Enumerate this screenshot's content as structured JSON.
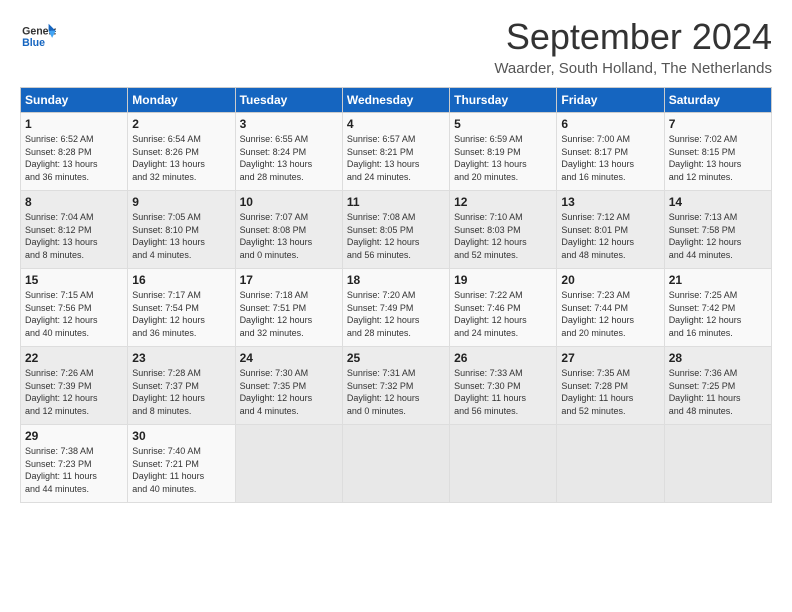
{
  "logo": {
    "line1": "General",
    "line2": "Blue"
  },
  "title": "September 2024",
  "location": "Waarder, South Holland, The Netherlands",
  "days_of_week": [
    "Sunday",
    "Monday",
    "Tuesday",
    "Wednesday",
    "Thursday",
    "Friday",
    "Saturday"
  ],
  "weeks": [
    [
      {
        "day": "1",
        "info": "Sunrise: 6:52 AM\nSunset: 8:28 PM\nDaylight: 13 hours\nand 36 minutes."
      },
      {
        "day": "2",
        "info": "Sunrise: 6:54 AM\nSunset: 8:26 PM\nDaylight: 13 hours\nand 32 minutes."
      },
      {
        "day": "3",
        "info": "Sunrise: 6:55 AM\nSunset: 8:24 PM\nDaylight: 13 hours\nand 28 minutes."
      },
      {
        "day": "4",
        "info": "Sunrise: 6:57 AM\nSunset: 8:21 PM\nDaylight: 13 hours\nand 24 minutes."
      },
      {
        "day": "5",
        "info": "Sunrise: 6:59 AM\nSunset: 8:19 PM\nDaylight: 13 hours\nand 20 minutes."
      },
      {
        "day": "6",
        "info": "Sunrise: 7:00 AM\nSunset: 8:17 PM\nDaylight: 13 hours\nand 16 minutes."
      },
      {
        "day": "7",
        "info": "Sunrise: 7:02 AM\nSunset: 8:15 PM\nDaylight: 13 hours\nand 12 minutes."
      }
    ],
    [
      {
        "day": "8",
        "info": "Sunrise: 7:04 AM\nSunset: 8:12 PM\nDaylight: 13 hours\nand 8 minutes."
      },
      {
        "day": "9",
        "info": "Sunrise: 7:05 AM\nSunset: 8:10 PM\nDaylight: 13 hours\nand 4 minutes."
      },
      {
        "day": "10",
        "info": "Sunrise: 7:07 AM\nSunset: 8:08 PM\nDaylight: 13 hours\nand 0 minutes."
      },
      {
        "day": "11",
        "info": "Sunrise: 7:08 AM\nSunset: 8:05 PM\nDaylight: 12 hours\nand 56 minutes."
      },
      {
        "day": "12",
        "info": "Sunrise: 7:10 AM\nSunset: 8:03 PM\nDaylight: 12 hours\nand 52 minutes."
      },
      {
        "day": "13",
        "info": "Sunrise: 7:12 AM\nSunset: 8:01 PM\nDaylight: 12 hours\nand 48 minutes."
      },
      {
        "day": "14",
        "info": "Sunrise: 7:13 AM\nSunset: 7:58 PM\nDaylight: 12 hours\nand 44 minutes."
      }
    ],
    [
      {
        "day": "15",
        "info": "Sunrise: 7:15 AM\nSunset: 7:56 PM\nDaylight: 12 hours\nand 40 minutes."
      },
      {
        "day": "16",
        "info": "Sunrise: 7:17 AM\nSunset: 7:54 PM\nDaylight: 12 hours\nand 36 minutes."
      },
      {
        "day": "17",
        "info": "Sunrise: 7:18 AM\nSunset: 7:51 PM\nDaylight: 12 hours\nand 32 minutes."
      },
      {
        "day": "18",
        "info": "Sunrise: 7:20 AM\nSunset: 7:49 PM\nDaylight: 12 hours\nand 28 minutes."
      },
      {
        "day": "19",
        "info": "Sunrise: 7:22 AM\nSunset: 7:46 PM\nDaylight: 12 hours\nand 24 minutes."
      },
      {
        "day": "20",
        "info": "Sunrise: 7:23 AM\nSunset: 7:44 PM\nDaylight: 12 hours\nand 20 minutes."
      },
      {
        "day": "21",
        "info": "Sunrise: 7:25 AM\nSunset: 7:42 PM\nDaylight: 12 hours\nand 16 minutes."
      }
    ],
    [
      {
        "day": "22",
        "info": "Sunrise: 7:26 AM\nSunset: 7:39 PM\nDaylight: 12 hours\nand 12 minutes."
      },
      {
        "day": "23",
        "info": "Sunrise: 7:28 AM\nSunset: 7:37 PM\nDaylight: 12 hours\nand 8 minutes."
      },
      {
        "day": "24",
        "info": "Sunrise: 7:30 AM\nSunset: 7:35 PM\nDaylight: 12 hours\nand 4 minutes."
      },
      {
        "day": "25",
        "info": "Sunrise: 7:31 AM\nSunset: 7:32 PM\nDaylight: 12 hours\nand 0 minutes."
      },
      {
        "day": "26",
        "info": "Sunrise: 7:33 AM\nSunset: 7:30 PM\nDaylight: 11 hours\nand 56 minutes."
      },
      {
        "day": "27",
        "info": "Sunrise: 7:35 AM\nSunset: 7:28 PM\nDaylight: 11 hours\nand 52 minutes."
      },
      {
        "day": "28",
        "info": "Sunrise: 7:36 AM\nSunset: 7:25 PM\nDaylight: 11 hours\nand 48 minutes."
      }
    ],
    [
      {
        "day": "29",
        "info": "Sunrise: 7:38 AM\nSunset: 7:23 PM\nDaylight: 11 hours\nand 44 minutes."
      },
      {
        "day": "30",
        "info": "Sunrise: 7:40 AM\nSunset: 7:21 PM\nDaylight: 11 hours\nand 40 minutes."
      },
      {
        "day": "",
        "info": ""
      },
      {
        "day": "",
        "info": ""
      },
      {
        "day": "",
        "info": ""
      },
      {
        "day": "",
        "info": ""
      },
      {
        "day": "",
        "info": ""
      }
    ]
  ]
}
